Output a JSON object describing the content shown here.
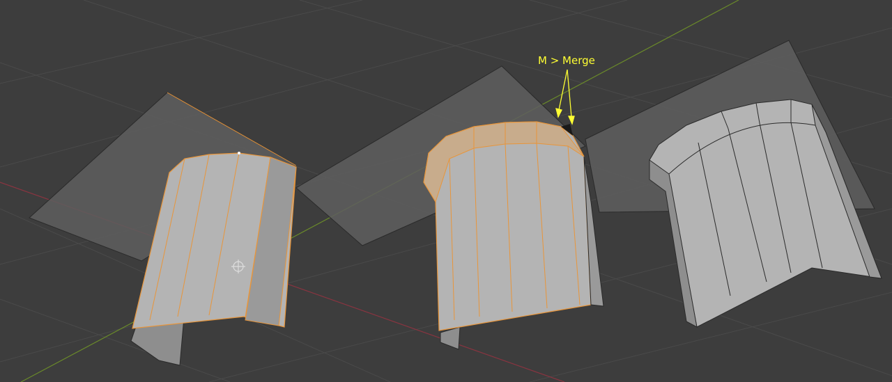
{
  "viewport": {
    "background_color": "#3d3d3d",
    "grid_line_color": "#4a4a4a",
    "x_axis_color": "#8a3440",
    "y_axis_color": "#6a8a2a",
    "plane_color": "#5e5e5e",
    "selection_color": "#e8953a",
    "mesh_face_color": "#b4b4b4",
    "mesh_dark_color": "#8e8e8e",
    "pivot_icon": "3d-cursor-icon"
  },
  "annotation": {
    "label": "M > Merge",
    "color": "#ffff33"
  }
}
